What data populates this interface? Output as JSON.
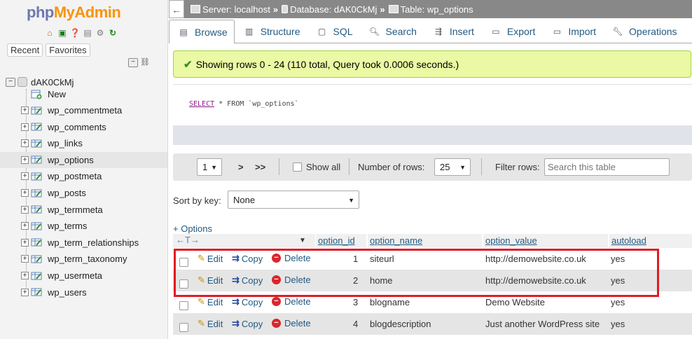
{
  "brand": {
    "php": "php",
    "admin": "MyAdmin"
  },
  "nav_icons": [
    "home-icon",
    "logout-icon",
    "help-icon",
    "docs-icon",
    "settings-icon",
    "reload-icon"
  ],
  "left": {
    "recent_label": "Recent",
    "favorites_label": "Favorites",
    "database": "dAK0CkMj",
    "new_label": "New",
    "tables": [
      "wp_commentmeta",
      "wp_comments",
      "wp_links",
      "wp_options",
      "wp_postmeta",
      "wp_posts",
      "wp_termmeta",
      "wp_terms",
      "wp_term_relationships",
      "wp_term_taxonomy",
      "wp_usermeta",
      "wp_users"
    ],
    "active_table": "wp_options"
  },
  "breadcrumb": {
    "server": "Server: localhost",
    "database": "Database: dAK0CkMj",
    "table": "Table: wp_options",
    "separator": "»"
  },
  "tabs": [
    {
      "label": "Browse",
      "icon": "browse-icon",
      "active": true
    },
    {
      "label": "Structure",
      "icon": "structure-icon"
    },
    {
      "label": "SQL",
      "icon": "sql-icon"
    },
    {
      "label": "Search",
      "icon": "search-icon"
    },
    {
      "label": "Insert",
      "icon": "insert-icon"
    },
    {
      "label": "Export",
      "icon": "export-icon"
    },
    {
      "label": "Import",
      "icon": "import-icon"
    },
    {
      "label": "Operations",
      "icon": "operations-icon"
    }
  ],
  "message": "Showing rows 0 - 24 (110 total, Query took 0.0006 seconds.)",
  "sql": {
    "keyword": "SELECT",
    "rest": " * FROM `wp_options`"
  },
  "pager": {
    "page": "1",
    "next": ">",
    "last": ">>",
    "show_all": "Show all",
    "rows_label": "Number of rows:",
    "rows_value": "25",
    "filter_label": "Filter rows:",
    "filter_placeholder": "Search this table"
  },
  "sort": {
    "label": "Sort by key:",
    "value": "None"
  },
  "options_link": "+ Options",
  "columns": [
    "option_id",
    "option_name",
    "option_value",
    "autoload"
  ],
  "actions": {
    "edit": "Edit",
    "copy": "Copy",
    "delete": "Delete"
  },
  "rows": [
    {
      "option_id": "1",
      "option_name": "siteurl",
      "option_value": "http://demowebsite.co.uk",
      "autoload": "yes"
    },
    {
      "option_id": "2",
      "option_name": "home",
      "option_value": "http://demowebsite.co.uk",
      "autoload": "yes"
    },
    {
      "option_id": "3",
      "option_name": "blogname",
      "option_value": "Demo Website",
      "autoload": "yes"
    },
    {
      "option_id": "4",
      "option_name": "blogdescription",
      "option_value": "Just another WordPress site",
      "autoload": "yes"
    }
  ],
  "colors": {
    "accent_link": "#235a81",
    "success_bg": "#ebf8a4",
    "highlight": "#e01b24"
  }
}
